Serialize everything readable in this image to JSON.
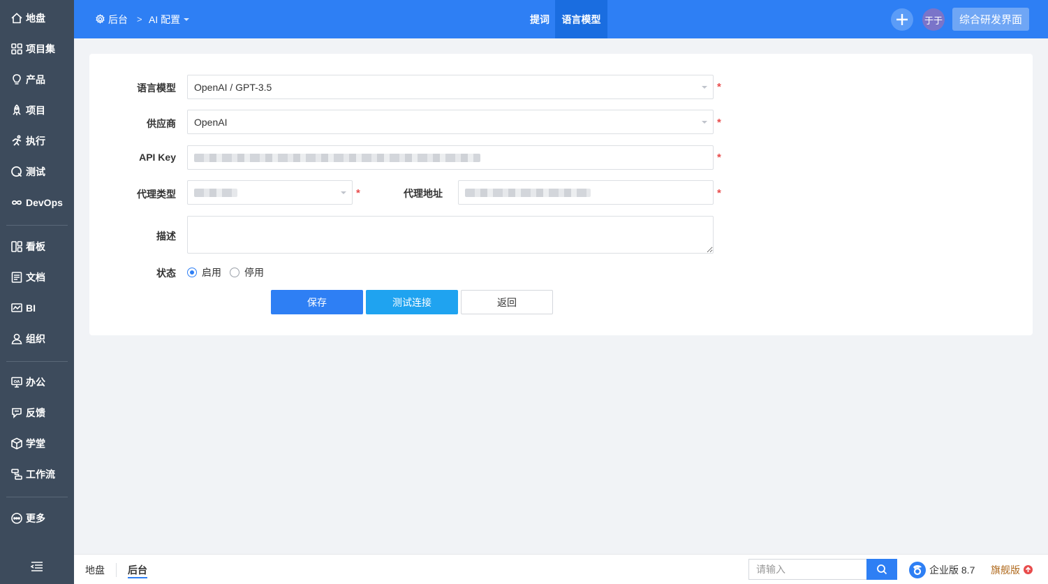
{
  "sidebar": {
    "items": [
      {
        "label": "地盘",
        "icon": "home-icon"
      },
      {
        "label": "项目集",
        "icon": "grid-icon"
      },
      {
        "label": "产品",
        "icon": "bulb-icon"
      },
      {
        "label": "项目",
        "icon": "rocket-icon"
      },
      {
        "label": "执行",
        "icon": "run-icon"
      },
      {
        "label": "测试",
        "icon": "test-icon"
      },
      {
        "label": "DevOps",
        "icon": "infinity-icon"
      },
      {
        "label": "看板",
        "icon": "kanban-icon"
      },
      {
        "label": "文档",
        "icon": "document-icon"
      },
      {
        "label": "BI",
        "icon": "chart-icon"
      },
      {
        "label": "组织",
        "icon": "user-icon"
      },
      {
        "label": "办公",
        "icon": "oa-icon"
      },
      {
        "label": "反馈",
        "icon": "feedback-icon"
      },
      {
        "label": "学堂",
        "icon": "cube-icon"
      },
      {
        "label": "工作流",
        "icon": "workflow-icon"
      },
      {
        "label": "更多",
        "icon": "more-icon"
      }
    ]
  },
  "header": {
    "breadcrumb_home": "后台",
    "breadcrumb_sep": ">",
    "breadcrumb_current": "AI 配置",
    "tabs": [
      {
        "label": "提词",
        "active": false
      },
      {
        "label": "语言模型",
        "active": true
      }
    ],
    "avatar_text": "于于",
    "switch_label": "综合研发界面",
    "accent_color": "#2e7ff4"
  },
  "form": {
    "model_label": "语言模型",
    "model_value": "OpenAI / GPT-3.5",
    "vendor_label": "供应商",
    "vendor_value": "OpenAI",
    "apikey_label": "API Key",
    "proxy_type_label": "代理类型",
    "proxy_addr_label": "代理地址",
    "desc_label": "描述",
    "status_label": "状态",
    "status_options": [
      {
        "label": "启用",
        "selected": true
      },
      {
        "label": "停用",
        "selected": false
      }
    ],
    "required_mark": "*"
  },
  "buttons": {
    "save": "保存",
    "test": "测试连接",
    "back": "返回"
  },
  "footer": {
    "home_link": "地盘",
    "admin_link": "后台",
    "search_placeholder": "请输入",
    "edition": "企业版 8.7",
    "flagship": "旗舰版"
  }
}
